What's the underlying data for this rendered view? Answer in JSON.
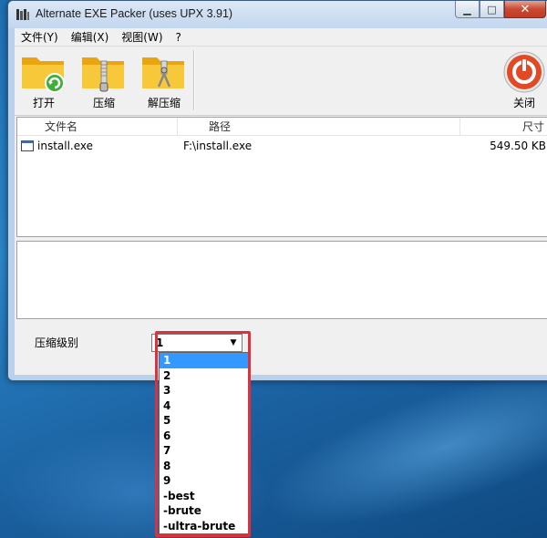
{
  "window": {
    "title": "Alternate EXE Packer (uses UPX 3.91)",
    "controls": {
      "minimize": "▁",
      "maximize": "□",
      "close": "✕"
    }
  },
  "menu": [
    "文件(Y)",
    "编辑(X)",
    "视图(W)",
    "?"
  ],
  "toolbar": {
    "open": "打开",
    "compress": "压缩",
    "decompress": "解压缩",
    "close": "关闭"
  },
  "list": {
    "columns": [
      "文件名",
      "路径",
      "尺寸"
    ],
    "rows": [
      {
        "name": "install.exe",
        "path": "F:\\install.exe",
        "size": "549.50 KB"
      }
    ]
  },
  "compression": {
    "label": "压缩级别",
    "selected": "1",
    "options": [
      "1",
      "2",
      "3",
      "4",
      "5",
      "6",
      "7",
      "8",
      "9",
      "-best",
      "-brute",
      "-ultra-brute"
    ]
  },
  "colors": {
    "selection": "#3399ff",
    "highlight_border": "#e0303c",
    "folder": "#f5c518"
  }
}
